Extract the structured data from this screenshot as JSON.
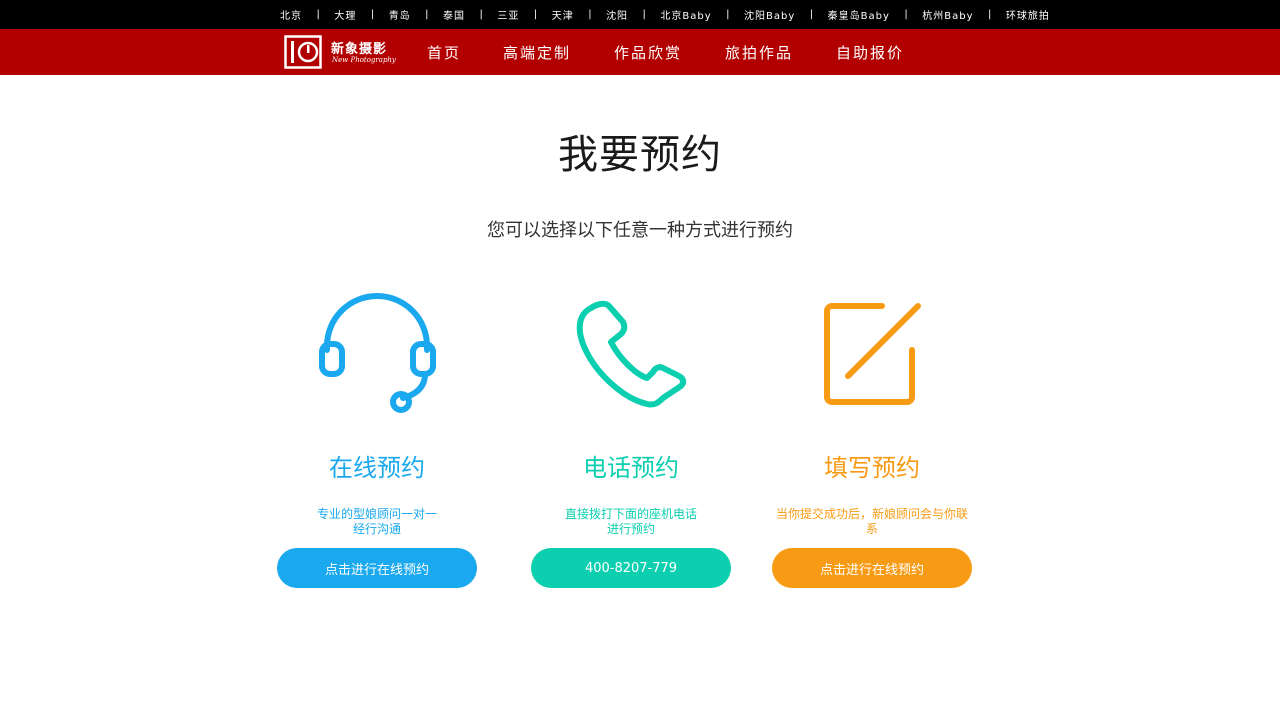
{
  "colors": {
    "topbar": "#000000",
    "navbar": "#b20000",
    "online": "#1aa8ee",
    "phone": "#0ccfb0",
    "form": "#f89b14"
  },
  "cities": [
    "北京",
    "大理",
    "青岛",
    "泰国",
    "三亚",
    "天津",
    "沈阳",
    "北京Baby",
    "沈阳Baby",
    "秦皇岛Baby",
    "杭州Baby",
    "环球旅拍"
  ],
  "logo": {
    "cn": "新象摄影",
    "en": "New Photography"
  },
  "nav": [
    "首页",
    "高端定制",
    "作品欣赏",
    "旅拍作品",
    "自助报价"
  ],
  "page": {
    "title": "我要预约",
    "subtitle": "您可以选择以下任意一种方式进行预约"
  },
  "methods": [
    {
      "icon": "headset-icon",
      "title": "在线预约",
      "desc_line1": "专业的型娘顾问一对一",
      "desc_line2": "经行沟通",
      "button": "点击进行在线预约"
    },
    {
      "icon": "phone-icon",
      "title": "电话预约",
      "desc_line1": "直接拨打下面的座机电话",
      "desc_line2": "进行预约",
      "button": "400-8207-779"
    },
    {
      "icon": "edit-icon",
      "title": "填写预约",
      "desc_line1": "当你提交成功后，新娘顾问会与你联系",
      "desc_line2": "",
      "button": "点击进行在线预约"
    }
  ]
}
